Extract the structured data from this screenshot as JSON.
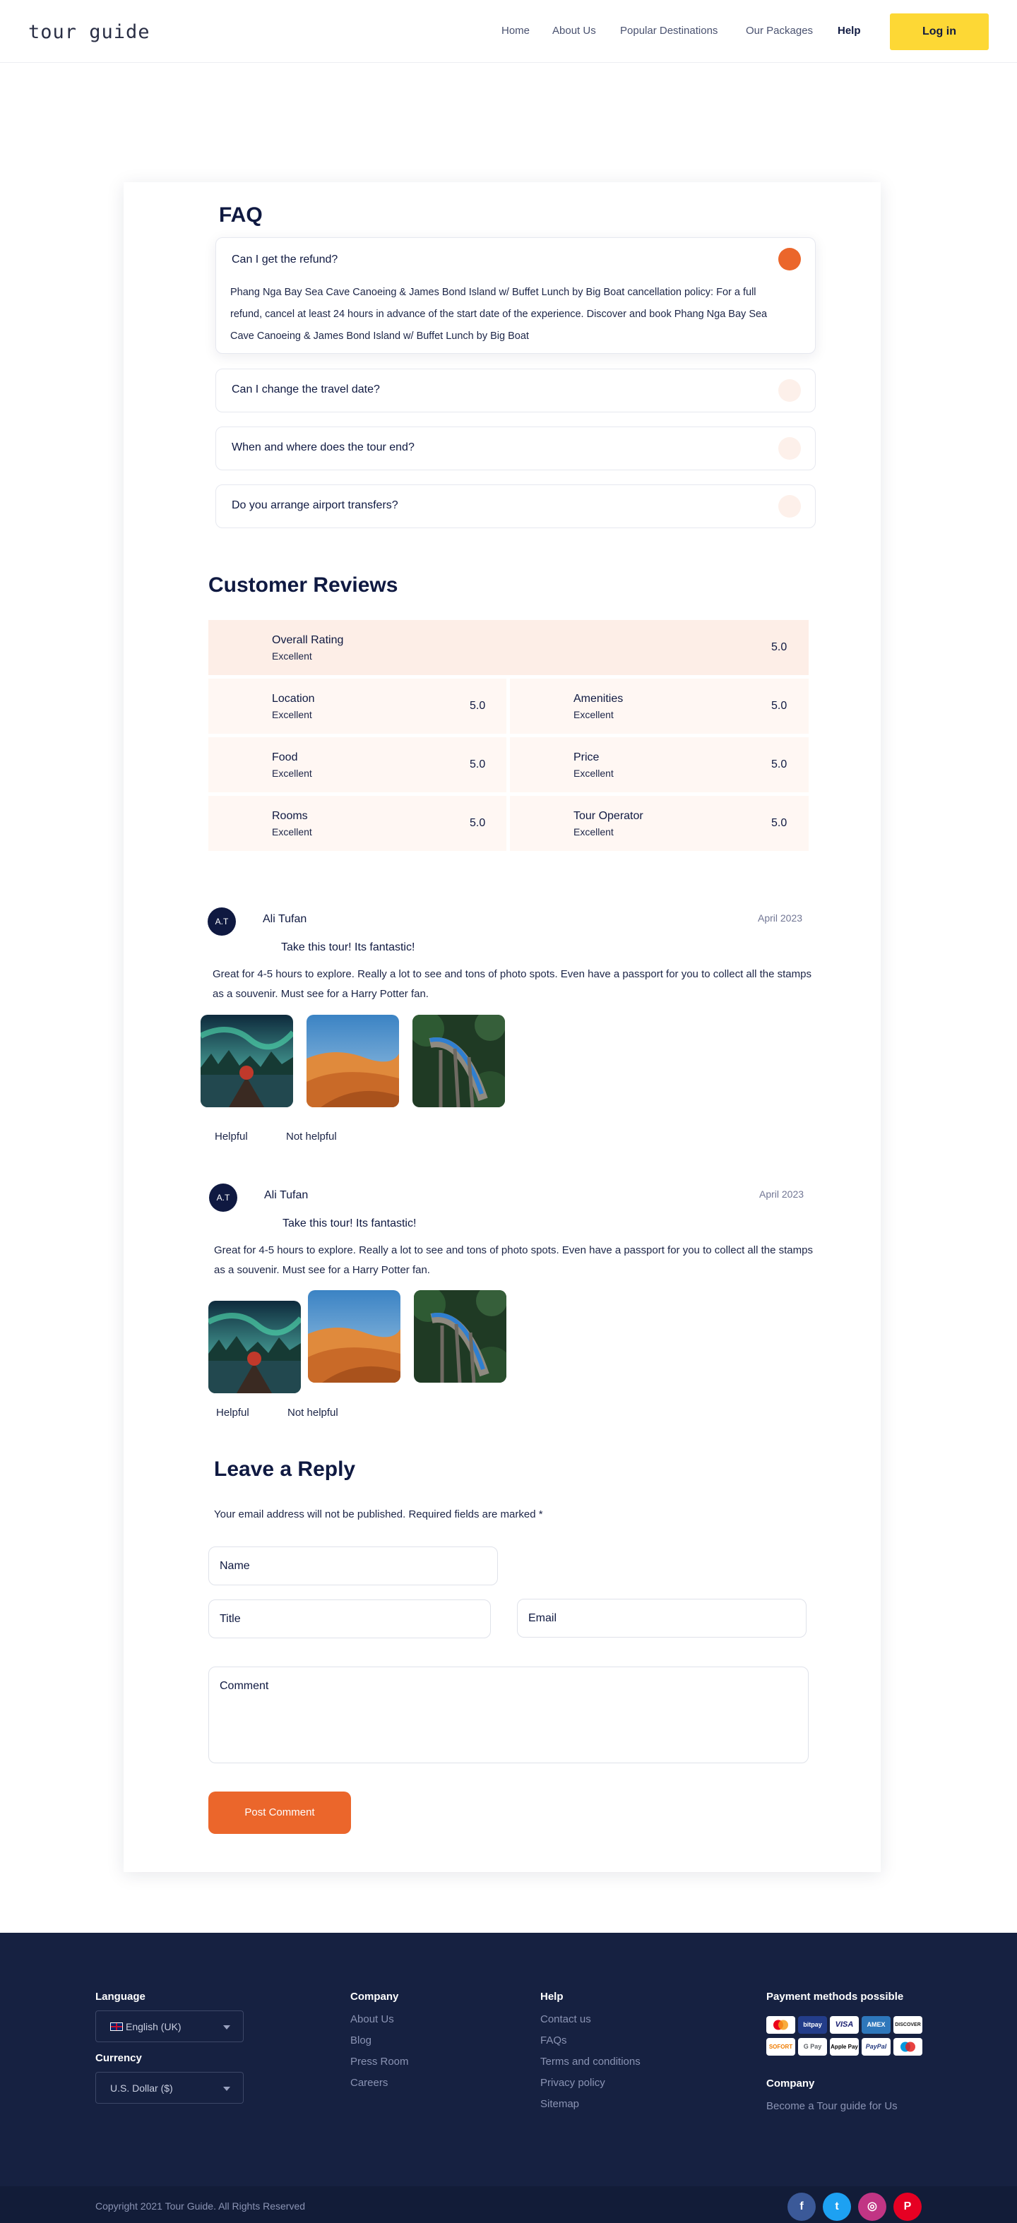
{
  "header": {
    "logo": "tour guide",
    "nav": [
      "Home",
      "About Us",
      "Popular Destinations",
      "Our Packages",
      "Help"
    ],
    "login": "Log in"
  },
  "faq": {
    "title": "FAQ",
    "items": [
      {
        "q": "Can I get the refund?",
        "a": "Phang Nga Bay Sea Cave Canoeing & James Bond Island w/ Buffet Lunch by Big Boat cancellation policy: For a full refund, cancel at least 24 hours in advance of the start date of the experience. Discover and book Phang Nga Bay Sea Cave Canoeing & James Bond Island w/ Buffet Lunch by Big Boat"
      },
      {
        "q": "Can I change the travel date?"
      },
      {
        "q": "When and where does the tour end?"
      },
      {
        "q": "Do you arrange airport transfers?"
      }
    ]
  },
  "reviews": {
    "title": "Customer Reviews",
    "overall": {
      "name": "Overall Rating",
      "sub": "Excellent",
      "value": "5.0"
    },
    "ratings": [
      {
        "name": "Location",
        "sub": "Excellent",
        "value": "5.0"
      },
      {
        "name": "Amenities",
        "sub": "Excellent",
        "value": "5.0"
      },
      {
        "name": "Food",
        "sub": "Excellent",
        "value": "5.0"
      },
      {
        "name": "Price",
        "sub": "Excellent",
        "value": "5.0"
      },
      {
        "name": "Rooms",
        "sub": "Excellent",
        "value": "5.0"
      },
      {
        "name": "Tour Operator",
        "sub": "Excellent",
        "value": "5.0"
      }
    ],
    "items": [
      {
        "initials": "A.T",
        "name": "Ali Tufan",
        "date": "April 2023",
        "title": "Take this tour! Its fantastic!",
        "text": "Great for 4-5 hours to explore. Really a lot to see and tons of photo spots. Even have a passport for you to collect all the stamps as a souvenir. Must see for a Harry Potter fan.",
        "helpful": "Helpful",
        "not_helpful": "Not helpful"
      },
      {
        "initials": "A.T",
        "name": "Ali Tufan",
        "date": "April 2023",
        "title": "Take this tour! Its fantastic!",
        "text": "Great for 4-5 hours to explore. Really a lot to see and tons of photo spots. Even have a passport for you to collect all the stamps as a souvenir. Must see for a Harry Potter fan.",
        "helpful": "Helpful",
        "not_helpful": "Not helpful"
      }
    ]
  },
  "reply": {
    "title": "Leave a Reply",
    "note": "Your email address will not be published. Required fields are marked *",
    "name_label": "Name",
    "title_label": "Title",
    "email_label": "Email",
    "comment_label": "Comment",
    "submit": "Post Comment"
  },
  "footer": {
    "language_head": "Language",
    "language_value": "English (UK)",
    "currency_head": "Currency",
    "currency_value": "U.S. Dollar ($)",
    "company_head": "Company",
    "company_links": [
      "About Us",
      "Blog",
      "Press Room",
      "Careers"
    ],
    "help_head": "Help",
    "help_links": [
      "Contact us",
      "FAQs",
      "Terms and conditions",
      "Privacy policy",
      "Sitemap"
    ],
    "payment_head": "Payment methods possible",
    "payments": [
      "Mastercard",
      "bitpay",
      "VISA",
      "AMEX",
      "DISCOVER",
      "SOFORT",
      "G Pay",
      "Apple Pay",
      "PayPal",
      "Maestro"
    ],
    "company2_head": "Company",
    "company2_link": "Become a Tour guide for Us",
    "copyright": "Copyright 2021 Tour Guide. All Rights Reserved",
    "socials": [
      "f",
      "t",
      "◎",
      "P"
    ]
  }
}
